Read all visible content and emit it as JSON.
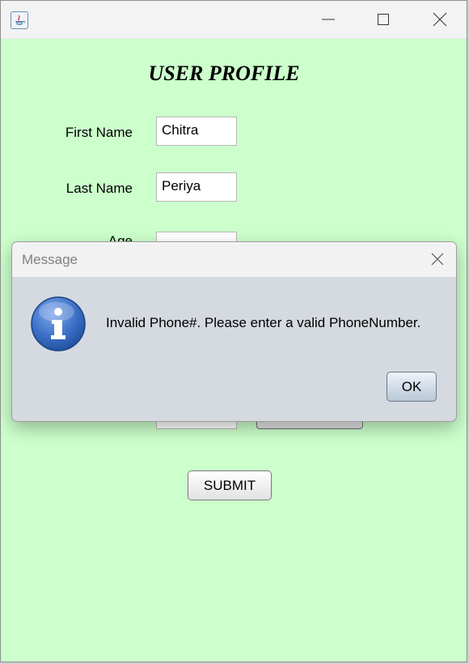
{
  "window": {
    "title": ""
  },
  "form": {
    "title": "USER PROFILE",
    "first_name_label": "First Name",
    "first_name_value": "Chitra",
    "last_name_label": "Last Name",
    "last_name_value": "Periya",
    "age_label": "Age",
    "submit_label": "SUBMIT"
  },
  "dialog": {
    "title": "Message",
    "message": "Invalid Phone#. Please enter a valid PhoneNumber.",
    "ok_label": "OK",
    "icon": "info-icon",
    "icon_color": "#3b6fc6"
  },
  "colors": {
    "form_background": "#ccffcc",
    "dialog_background": "#d5d9e0"
  }
}
